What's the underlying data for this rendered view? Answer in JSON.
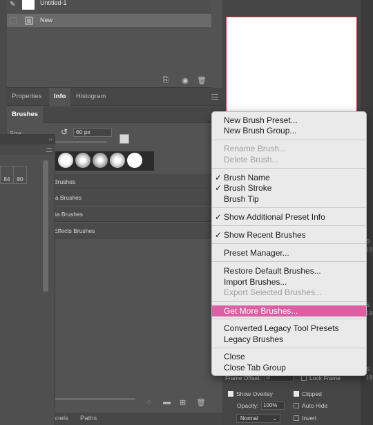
{
  "history": {
    "items": [
      {
        "label": "Untitled-1"
      },
      {
        "label": "New"
      }
    ]
  },
  "info_tabs": [
    "Properties",
    "Info",
    "Histogram"
  ],
  "brushes": {
    "tab": "Brushes",
    "size_label": "Size:",
    "size_value": "60 px",
    "groups": [
      "Brushes",
      "ia Brushes",
      "lia Brushes",
      "Effects Brushes"
    ]
  },
  "presets_panel": {
    "collapse_glyph": "‹‹",
    "cells": [
      "84",
      "80"
    ]
  },
  "bottom_tabs": [
    "nnels",
    "Paths"
  ],
  "options": {
    "frame_offset_label": "Frame Offset:",
    "frame_offset_value": "0",
    "lock_frame": "Lock Frame",
    "show_overlay": "Show Overlay",
    "clipped": "Clipped",
    "opacity_label": "Opacity:",
    "opacity_value": "100%",
    "auto_hide": "Auto Hide",
    "blend_mode": "Normal",
    "invert": "Invert"
  },
  "right_edge_fragments": [
    "S",
    "19",
    "S",
    "19",
    "S",
    "19"
  ],
  "context_menu": {
    "groups": [
      [
        {
          "label": "New Brush Preset...",
          "enabled": true,
          "checked": false
        },
        {
          "label": "New Brush Group...",
          "enabled": true,
          "checked": false
        }
      ],
      [
        {
          "label": "Rename Brush...",
          "enabled": false,
          "checked": false
        },
        {
          "label": "Delete Brush...",
          "enabled": false,
          "checked": false
        }
      ],
      [
        {
          "label": "Brush Name",
          "enabled": true,
          "checked": true
        },
        {
          "label": "Brush Stroke",
          "enabled": true,
          "checked": true
        },
        {
          "label": "Brush Tip",
          "enabled": true,
          "checked": false
        }
      ],
      [
        {
          "label": "Show Additional Preset Info",
          "enabled": true,
          "checked": true
        }
      ],
      [
        {
          "label": "Show Recent Brushes",
          "enabled": true,
          "checked": true
        }
      ],
      [
        {
          "label": "Preset Manager...",
          "enabled": true,
          "checked": false
        }
      ],
      [
        {
          "label": "Restore Default Brushes...",
          "enabled": true,
          "checked": false
        },
        {
          "label": "Import Brushes...",
          "enabled": true,
          "checked": false
        },
        {
          "label": "Export Selected Brushes...",
          "enabled": false,
          "checked": false
        }
      ],
      [
        {
          "label": "Get More Brushes...",
          "enabled": true,
          "checked": false,
          "highlighted": true
        }
      ],
      [
        {
          "label": "Converted Legacy Tool Presets",
          "enabled": true,
          "checked": false
        },
        {
          "label": "Legacy Brushes",
          "enabled": true,
          "checked": false
        }
      ],
      [
        {
          "label": "Close",
          "enabled": true,
          "checked": false
        },
        {
          "label": "Close Tab Group",
          "enabled": true,
          "checked": false
        }
      ]
    ],
    "check_glyph": "✓"
  },
  "colors": {
    "highlight": "#dd5ea4",
    "canvas_border": "#c13a3a",
    "panel_bg": "#535353"
  }
}
